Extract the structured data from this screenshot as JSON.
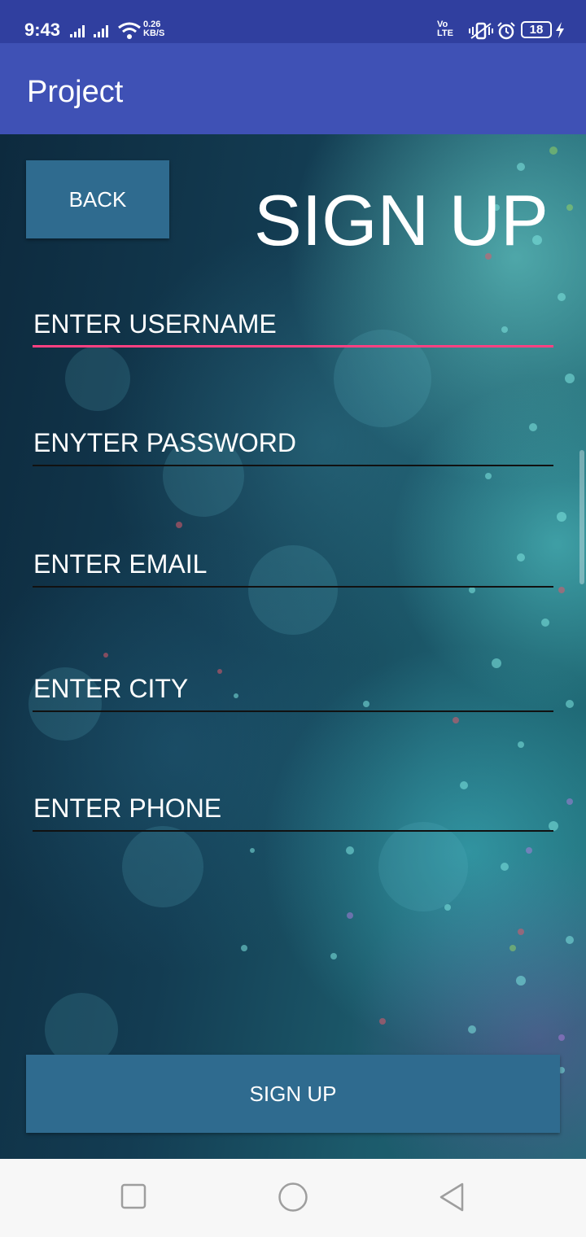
{
  "status_bar": {
    "time": "9:43",
    "net_speed_value": "0.26",
    "net_speed_unit": "KB/S",
    "volte_top": "Vo",
    "volte_bottom": "LTE",
    "battery": "18"
  },
  "app_bar": {
    "title": "Project"
  },
  "form": {
    "back_label": "BACK",
    "heading": "SIGN UP",
    "fields": [
      {
        "label": "ENTER USERNAME"
      },
      {
        "label": "ENYTER PASSWORD"
      },
      {
        "label": "ENTER EMAIL"
      },
      {
        "label": "ENTER CITY"
      },
      {
        "label": "ENTER PHONE"
      }
    ],
    "submit_label": "SIGN UP"
  },
  "colors": {
    "status_bar": "#303f9f",
    "app_bar": "#3f51b5",
    "button": "#2f6b8f",
    "accent_underline": "#ff4081",
    "nav_icon": "#9e9e9e"
  },
  "nav_bar": {
    "icons": [
      "recent-apps-icon",
      "home-icon",
      "back-icon"
    ]
  }
}
